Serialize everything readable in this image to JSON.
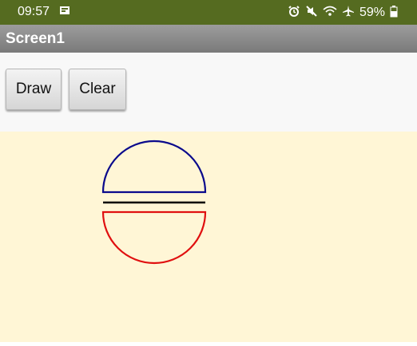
{
  "status_bar": {
    "time": "09:57",
    "battery_percent": "59%",
    "icons": [
      "screenshot-icon",
      "alarm-icon",
      "mute-icon",
      "wifi-icon",
      "airplane-mode-icon",
      "battery-icon"
    ]
  },
  "app_bar": {
    "title": "Screen1"
  },
  "toolbar": {
    "draw_label": "Draw",
    "clear_label": "Clear"
  },
  "canvas": {
    "background_color": "#fff6d6",
    "shapes": [
      "upper-semicircle",
      "divider-line",
      "lower-semicircle"
    ],
    "colors": {
      "upper": "#0a0a8c",
      "line": "#000000",
      "lower": "#e01010"
    }
  }
}
